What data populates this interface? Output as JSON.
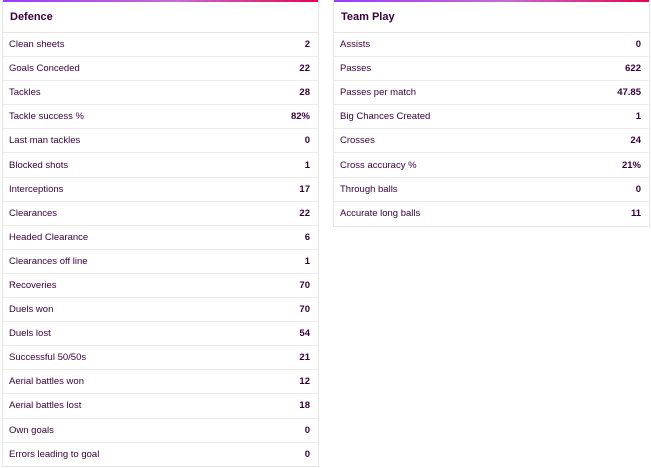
{
  "defence": {
    "title": "Defence",
    "rows": [
      {
        "label": "Clean sheets",
        "value": "2"
      },
      {
        "label": "Goals Conceded",
        "value": "22"
      },
      {
        "label": "Tackles",
        "value": "28"
      },
      {
        "label": "Tackle success %",
        "value": "82%"
      },
      {
        "label": "Last man tackles",
        "value": "0"
      },
      {
        "label": "Blocked shots",
        "value": "1"
      },
      {
        "label": "Interceptions",
        "value": "17"
      },
      {
        "label": "Clearances",
        "value": "22"
      },
      {
        "label": "Headed Clearance",
        "value": "6"
      },
      {
        "label": "Clearances off line",
        "value": "1"
      },
      {
        "label": "Recoveries",
        "value": "70"
      },
      {
        "label": "Duels won",
        "value": "70"
      },
      {
        "label": "Duels lost",
        "value": "54"
      },
      {
        "label": "Successful 50/50s",
        "value": "21"
      },
      {
        "label": "Aerial battles won",
        "value": "12"
      },
      {
        "label": "Aerial battles lost",
        "value": "18"
      },
      {
        "label": "Own goals",
        "value": "0"
      },
      {
        "label": "Errors leading to goal",
        "value": "0"
      }
    ]
  },
  "team_play": {
    "title": "Team Play",
    "rows": [
      {
        "label": "Assists",
        "value": "0"
      },
      {
        "label": "Passes",
        "value": "622"
      },
      {
        "label": "Passes per match",
        "value": "47.85"
      },
      {
        "label": "Big Chances Created",
        "value": "1"
      },
      {
        "label": "Crosses",
        "value": "24"
      },
      {
        "label": "Cross accuracy %",
        "value": "21%"
      },
      {
        "label": "Through balls",
        "value": "0"
      },
      {
        "label": "Accurate long balls",
        "value": "11"
      }
    ]
  },
  "colors": {
    "text": "#37003c",
    "accent_start": "#963cff",
    "accent_end": "#e90052"
  }
}
